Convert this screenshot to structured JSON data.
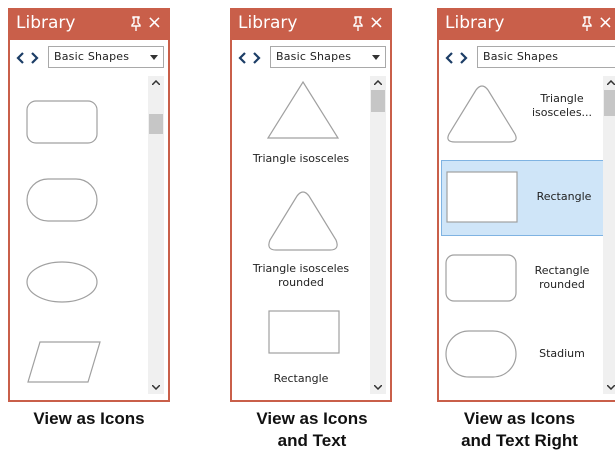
{
  "panels": [
    {
      "title": "Library",
      "close_glyph": "×",
      "pin_icon": "pin-icon",
      "category": "Basic Shapes",
      "view_mode": "View as Icons",
      "items": [
        {
          "shape": "rectangle-rounded-icon"
        },
        {
          "shape": "stadium-icon"
        },
        {
          "shape": "ellipse-icon"
        },
        {
          "shape": "parallelogram-icon"
        }
      ]
    },
    {
      "title": "Library",
      "close_glyph": "×",
      "pin_icon": "pin-icon",
      "category": "Basic Shapes",
      "view_mode": "View as Icons and Text",
      "items": [
        {
          "shape": "triangle-isosceles-icon",
          "label": "Triangle isosceles"
        },
        {
          "shape": "triangle-isosceles-rounded-icon",
          "label": "Triangle isosceles rounded"
        },
        {
          "shape": "rectangle-icon",
          "label": "Rectangle"
        }
      ]
    },
    {
      "title": "Library",
      "close_glyph": "×",
      "pin_icon": "pin-icon",
      "category": "Basic Shapes",
      "view_mode": "View as Icons and Text Right",
      "items": [
        {
          "shape": "triangle-isosceles-icon",
          "label": "Triangle isosceles..."
        },
        {
          "shape": "rectangle-icon",
          "label": "Rectangle",
          "selected": true
        },
        {
          "shape": "rectangle-rounded-icon",
          "label": "Rectangle rounded"
        },
        {
          "shape": "stadium-icon",
          "label": "Stadium"
        }
      ]
    }
  ],
  "captions": {
    "icons": [
      "View as Icons"
    ],
    "icons_text": [
      "View as Icons",
      "and Text"
    ],
    "icons_text_right": [
      "View as Icons",
      "and Text Right"
    ]
  },
  "colors": {
    "titlebar": "#c95f4a",
    "selection": "#cfe5f8",
    "selection_border": "#7fb3e2",
    "shape_stroke": "#a0a0a0"
  }
}
